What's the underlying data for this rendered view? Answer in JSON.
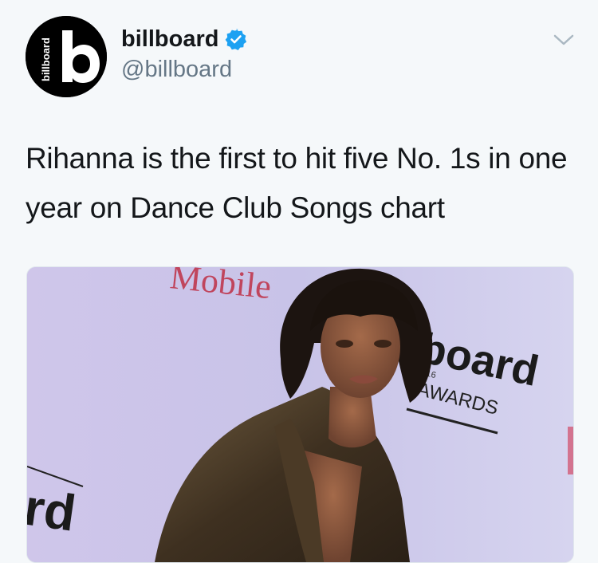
{
  "account": {
    "display_name": "billboard",
    "handle": "@billboard",
    "verified": true,
    "avatar_logo_text": "billboard",
    "avatar_letter": "b"
  },
  "tweet": {
    "text": "Rihanna is the first to hit five No. 1s in one year on Dance Club Songs chart"
  },
  "media": {
    "backdrop_texts": [
      "Mobile",
      "board",
      "2016",
      "AWARDS",
      "rd"
    ]
  },
  "icons": {
    "verified": "verified-badge-icon",
    "menu": "chevron-down-icon"
  },
  "colors": {
    "background": "#f5f8fa",
    "text": "#14171a",
    "secondary_text": "#657786",
    "verified_blue": "#1da1f2",
    "caret": "#aab8c2"
  }
}
